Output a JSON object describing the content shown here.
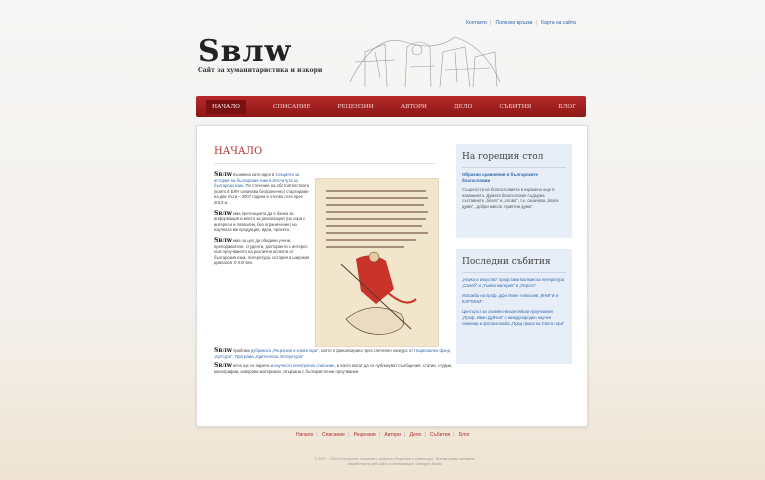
{
  "top_links": [
    "Контакти",
    "Полезни връзки",
    "Карта на сайта"
  ],
  "logo": {
    "title": "Sвлw",
    "subtitle": "Сайт за хуманитаристика и изкори"
  },
  "nav": [
    "НАЧАЛО",
    "СПИСАНИЕ",
    "РЕЦЕНЗИИ",
    "АВТОРИ",
    "ДЕЛО",
    "СЪБИТИЯ",
    "БЛОГ"
  ],
  "main": {
    "title": "НАЧАЛО",
    "brand": "Sвлw",
    "p1_text": " възникна като идея в ",
    "p1_link": "Секцията за история на българския език в Института за български език",
    "p1_rest": ". По стечение на обстоятелствата (които в БЛН означава безгранично) стартираме на две пъти – 2007 година и отново сега през 2012-а.",
    "p2_text": " има претенцията да е банка за информация и място за реализация (на хора с интереси и похвални, без ограничение) на научната им продукция, идеи, проекти.",
    "p3_text": " има за цел да обедини учени, преподаватели, студенти, докторанти с интерес към проучването на различни аспекти от българския език, литература, история в широкия диапазон X-XXI век.",
    "p4_text": " приближ ",
    "p4_link1": "рубриката „Рецензии и коментари“",
    "p4_mid": ", която е финансирана чрез спечелен конкурс от ",
    "p4_link2": "Национален фонд „Култура“, Програма „Критическа литература“",
    "p4_end": ".",
    "p5_text": " вече ще се нарича и ",
    "p5_link": "научното електронно списание",
    "p5_rest": ", в което могат да се публикуват съобщения, статии, студии, монографии, изворови материали, свързани с българистични проучвания."
  },
  "sidebar": {
    "desk_title": "На горещия стол",
    "desk_link": "Образни сравнения в българските благословии",
    "desk_text": "Същността на благословията в изразена още в названието. Думата благословия съдържа съставните „благо“ и „слово“, т.е. означава „благи думи“, „добри мисли, приятни думи“.",
    "events_title": "Последни събития",
    "events": [
      "„Наука и изкуство“ представи Балканска литература „Салеб“ и „Тъмна материя“ в „Перото“",
      "Изложба на проф. дфн Моне Алексиев „КНИГИ и КАРТИНИ“",
      "Центърът за славяно-византийски проучвания „Проф. Иван Дуйчев“ с международен научен семинар и фотоизложба „Пред праха на Света гора“"
    ]
  },
  "footer_nav": [
    "Начало",
    "Списание",
    "Рецензии",
    "Автори",
    "Дело",
    "Събития",
    "Блог"
  ],
  "copyright": "© 2007 – 2019 Електронно списание с рубрика „Рецензии и коментари“. Всички права запазени.",
  "credit": "Изработка на уеб сайта и оптимизация: Strangers Studio",
  "colors": {
    "nav_red": "#9a1c1c",
    "title_red": "#b02a2a",
    "link_blue": "#3366aa",
    "sidebar_bg": "#e7eef7"
  }
}
